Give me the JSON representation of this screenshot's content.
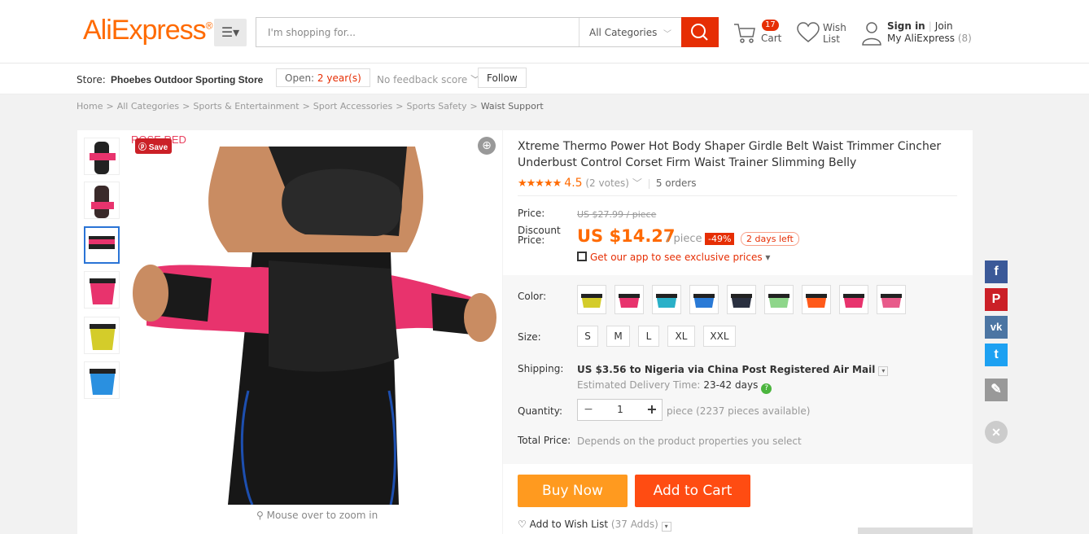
{
  "header": {
    "logo": "AliExpress",
    "logo_mark": "®",
    "menu_icon": "☰▾",
    "search_placeholder": "I'm shopping for...",
    "category": "All Categories",
    "cart_count": "17",
    "cart_label": "Cart",
    "wish_label": "Wish List",
    "sign_in": "Sign in",
    "join": "Join",
    "my_ali": "My AliExpress",
    "my_ali_count": "(8)"
  },
  "store": {
    "label": "Store:",
    "name": "Phoebes Outdoor Sporting Store",
    "open_label": "Open:",
    "open_years": "2 year(s)",
    "feedback": "No feedback score",
    "follow": "Follow"
  },
  "breadcrumbs": [
    "Home",
    "All Categories",
    "Sports & Entertainment",
    "Sport Accessories",
    "Sports Safety",
    "Waist Support"
  ],
  "gallery": {
    "save": "Save",
    "overlay_text": "ROSE RED",
    "zoom_hint": "Mouse over to zoom in",
    "thumb_colors": [
      "#e8336d",
      "#e8336d",
      "#2a2a2a",
      "#e8336d",
      "#d4cc2a",
      "#2aa0e6"
    ]
  },
  "product": {
    "title": "Xtreme Thermo Power Hot Body Shaper Girdle Belt Waist Trimmer Cincher Underbust Control Corset Firm Waist Trainer Slimming Belly",
    "stars": "★★★★★",
    "rating": "4.5",
    "votes": "(2 votes)",
    "orders": "5 orders",
    "price_label": "Price:",
    "old_price": "US $27.99 / piece",
    "discount_label": "Discount Price:",
    "discount_price": "US $14.27",
    "unit": "/ piece",
    "off": "-49%",
    "days_left": "2 days left",
    "app_promo": "Get our app to see exclusive prices",
    "color_label": "Color:",
    "colors": [
      "#d4cc2a",
      "#e8336d",
      "#2ab0c8",
      "#2a7ad6",
      "#2a3040",
      "#8ed68a",
      "#ff5a1a",
      "#e8336d",
      "#e85a8a"
    ],
    "size_label": "Size:",
    "sizes": [
      "S",
      "M",
      "L",
      "XL",
      "XXL"
    ],
    "shipping_label": "Shipping:",
    "shipping": "US $3.56 to Nigeria via China Post Registered Air Mail",
    "delivery_label": "Estimated Delivery Time:",
    "delivery_days": "23-42 days",
    "quantity_label": "Quantity:",
    "quantity": "1",
    "available": "piece (2237 pieces available)",
    "total_label": "Total Price:",
    "total": "Depends on the product properties you select",
    "buy_now": "Buy Now",
    "add_to_cart": "Add to Cart",
    "wishlist": "Add to Wish List",
    "wishlist_count": "(37 Adds)"
  },
  "social": [
    {
      "name": "facebook-icon",
      "glyph": "f",
      "color": "#3b5998"
    },
    {
      "name": "pinterest-icon",
      "glyph": "P",
      "color": "#cb2027"
    },
    {
      "name": "vk-icon",
      "glyph": "vk",
      "color": "#4c75a3"
    },
    {
      "name": "twitter-icon",
      "glyph": "t",
      "color": "#1da1f2"
    },
    {
      "name": "edit-icon",
      "glyph": "✎",
      "color": "#999999"
    }
  ]
}
